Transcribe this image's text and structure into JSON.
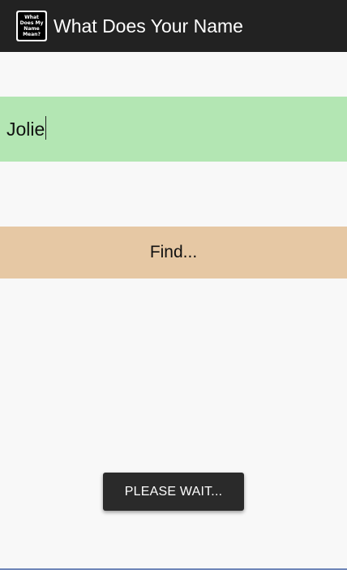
{
  "action_bar": {
    "title": "What Does Your Name",
    "icon": {
      "name": "app-logo-icon",
      "lines": [
        "What",
        "Does My",
        "Name",
        "Mean?"
      ]
    }
  },
  "name_input": {
    "value": "Jolie"
  },
  "find_button": {
    "label": "Find..."
  },
  "toast": {
    "message": "PLEASE WAIT..."
  },
  "colors": {
    "action_bar": "#222222",
    "input_bg": "#b3e6b3",
    "button_bg": "#e6c8a4",
    "toast_bg": "#2a2a2a",
    "page_bg": "#f8f8f8"
  }
}
